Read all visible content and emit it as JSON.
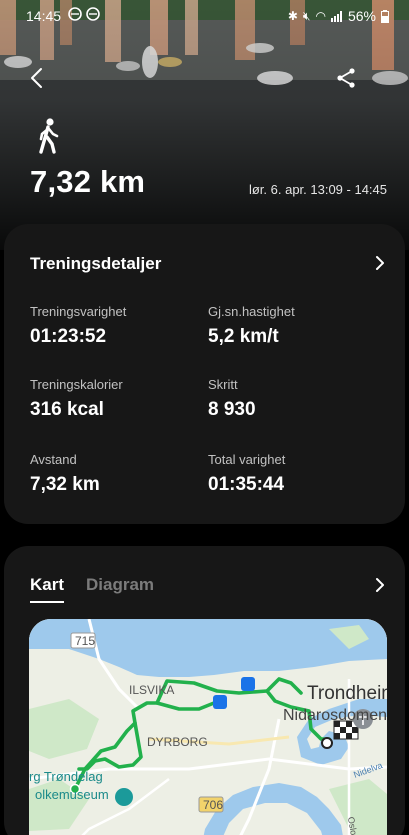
{
  "status_bar": {
    "time": "14:45",
    "battery": "56%"
  },
  "header": {
    "activity_icon": "walk-icon",
    "distance": "7,32 km",
    "date_range": "lør. 6. apr. 13:09 - 14:45"
  },
  "details": {
    "title": "Treningsdetaljer",
    "stats": [
      {
        "label": "Treningsvarighet",
        "value": "01:23:52"
      },
      {
        "label": "Gj.sn.hastighet",
        "value": "5,2 km/t"
      },
      {
        "label": "Treningskalorier",
        "value": "316 kcal"
      },
      {
        "label": "Skritt",
        "value": "8 930"
      },
      {
        "label": "Avstand",
        "value": "7,32 km"
      },
      {
        "label": "Total varighet",
        "value": "01:35:44"
      }
    ]
  },
  "map_card": {
    "tabs": [
      {
        "label": "Kart"
      },
      {
        "label": "Diagram"
      }
    ],
    "active_tab": "Kart",
    "labels": {
      "road_715": "715",
      "road_706": "706",
      "ilsvika": "ILSVIKA",
      "dyrborg": "DYRBORG",
      "trondheim": "Trondheim",
      "nidarosdomen": "Nidarosdomen",
      "museum_line1": "rg Trøndelag",
      "museum_line2": "olkemuseum",
      "nidelva": "Nidelva",
      "oslovegen": "Oslovegen"
    }
  },
  "colors": {
    "background": "#000000",
    "card": "#171717",
    "route": "#22b14c",
    "water": "#9ec9ec"
  }
}
